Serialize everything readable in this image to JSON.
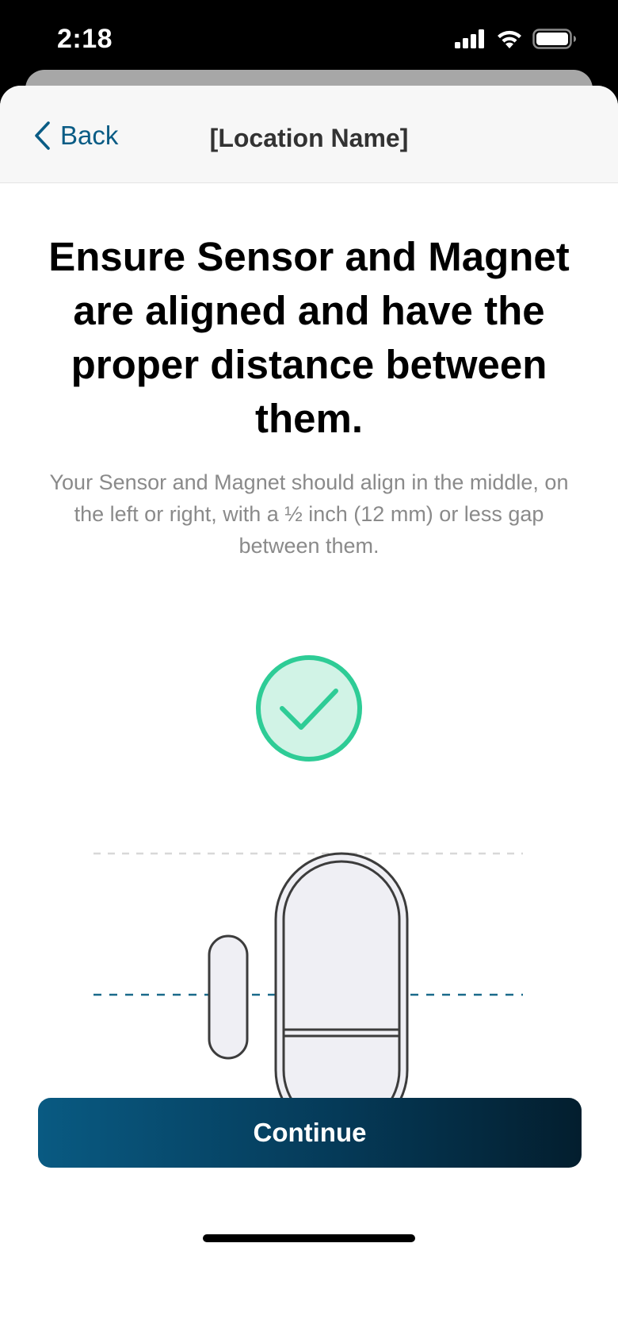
{
  "status_bar": {
    "time": "2:18",
    "icons": [
      "cellular-signal-icon",
      "wifi-icon",
      "battery-icon"
    ]
  },
  "nav": {
    "back_label": "Back",
    "title": "[Location Name]"
  },
  "content": {
    "headline": "Ensure Sensor and Magnet are aligned and have the proper distance between them.",
    "description": "Your Sensor and Magnet should align in the middle, on the left or right, with a ½ inch (12 mm) or less gap between them."
  },
  "illustration": {
    "icons": [
      "checkmark-circle-icon",
      "magnet-icon",
      "sensor-icon"
    ],
    "check_color": "#2ecc96",
    "guide_color": "#1a6a8a"
  },
  "actions": {
    "continue_label": "Continue"
  },
  "colors": {
    "accent": "#0a5c85",
    "button_gradient_start": "#095a82",
    "button_gradient_end": "#031e2e"
  }
}
